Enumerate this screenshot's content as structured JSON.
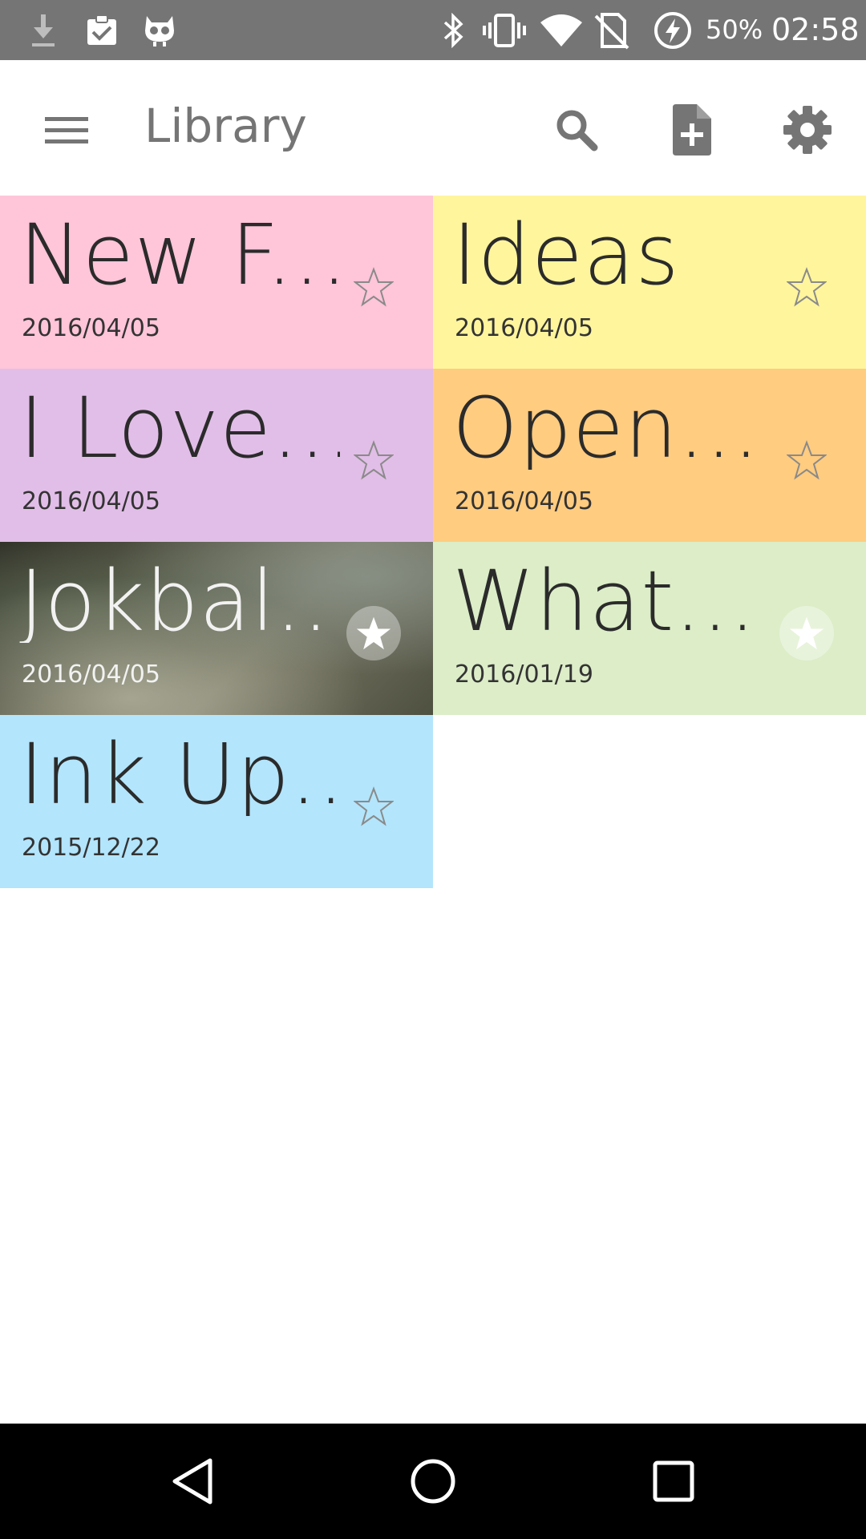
{
  "status_bar": {
    "battery": "50%",
    "time": "02:58",
    "icons": [
      "download-icon",
      "clipboard-check-icon",
      "cyanogen-mascot-icon",
      "bluetooth-icon",
      "vibrate-icon",
      "wifi-icon",
      "no-sim-icon",
      "battery-charging-icon"
    ]
  },
  "app_bar": {
    "title": "Library",
    "icons": [
      "menu-icon",
      "search-icon",
      "new-document-icon",
      "settings-icon"
    ]
  },
  "notebooks": [
    {
      "name": "New F...",
      "date": "2016/04/05",
      "color": "#ffc5d9",
      "starred": false
    },
    {
      "name": "Ideas",
      "date": "2016/04/05",
      "color": "#fff59d",
      "starred": false
    },
    {
      "name": "I Love...",
      "date": "2016/04/05",
      "color": "#e1bee7",
      "starred": false
    },
    {
      "name": "Open...",
      "date": "2016/04/05",
      "color": "#ffcc80",
      "starred": false
    },
    {
      "name": "Jokbal...",
      "date": "2016/04/05",
      "color": "photo",
      "starred": true
    },
    {
      "name": "What...",
      "date": "2016/01/19",
      "color": "#dcedc8",
      "starred": true
    },
    {
      "name": "Ink Up...",
      "date": "2015/12/22",
      "color": "#b3e5fc",
      "starred": false
    }
  ],
  "nav_bar": {
    "icons": [
      "back-icon",
      "home-icon",
      "recents-icon"
    ]
  }
}
